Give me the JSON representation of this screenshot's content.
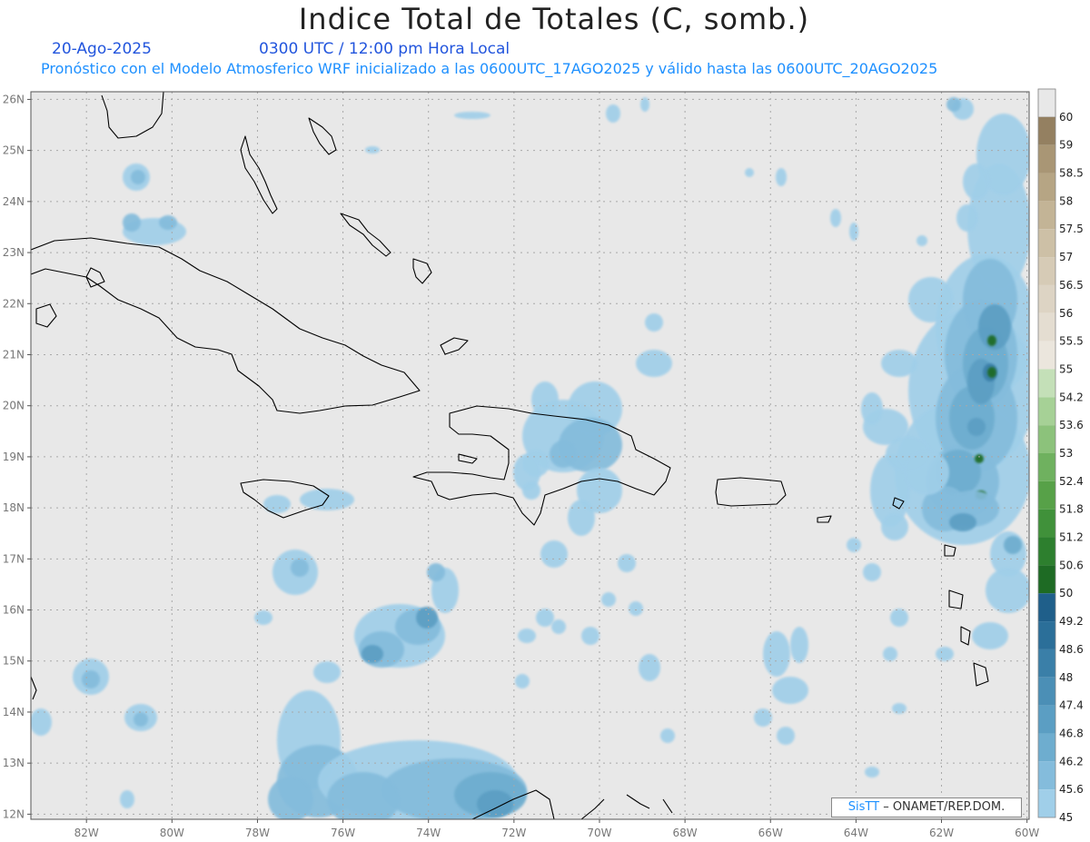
{
  "header": {
    "title": "Indice Total de Totales (C, somb.)",
    "date": "20-Ago-2025",
    "time": "0300 UTC / 12:00 pm Hora Local",
    "model_info": "Pronóstico con el Modelo Atmosferico WRF inicializado a las 0600UTC_17AGO2025 y válido hasta las  0600UTC_20AGO2025"
  },
  "credit": {
    "sis": "SisTT",
    "org": " – ONAMET/REP.DOM."
  },
  "map": {
    "lat_labels": [
      "26N",
      "25N",
      "24N",
      "23N",
      "22N",
      "21N",
      "20N",
      "19N",
      "18N",
      "17N",
      "16N",
      "15N",
      "14N",
      "13N",
      "12N"
    ],
    "lon_labels": [
      "82W",
      "80W",
      "78W",
      "76W",
      "74W",
      "72W",
      "70W",
      "68W",
      "66W",
      "64W",
      "62W",
      "60W"
    ],
    "background_color": "#e8e8e8",
    "coast_color": "#000000"
  },
  "legend": {
    "levels": [
      "60",
      "59",
      "58.5",
      "58",
      "57.5",
      "57",
      "56.5",
      "56",
      "55.5",
      "55",
      "54.2",
      "53.6",
      "53",
      "52.4",
      "51.8",
      "51.2",
      "50.6",
      "50",
      "49.2",
      "48.6",
      "48",
      "47.4",
      "46.8",
      "46.2",
      "45.6",
      "45"
    ],
    "colors": [
      "#948061",
      "#a99675",
      "#b6a584",
      "#c3b496",
      "#cdc0a6",
      "#d6cbb6",
      "#ddd4c4",
      "#e4ddd1",
      "#ebe6dd",
      "#c4e0b8",
      "#a6d196",
      "#8cc27b",
      "#6fb15f",
      "#57a148",
      "#40913a",
      "#2d7f2e",
      "#1e6b24",
      "#1f5f8a",
      "#2b6f99",
      "#3a7fa8",
      "#4b8fb6",
      "#5b9ec3",
      "#6eadcf",
      "#84bcdc",
      "#a0cfe9"
    ]
  }
}
